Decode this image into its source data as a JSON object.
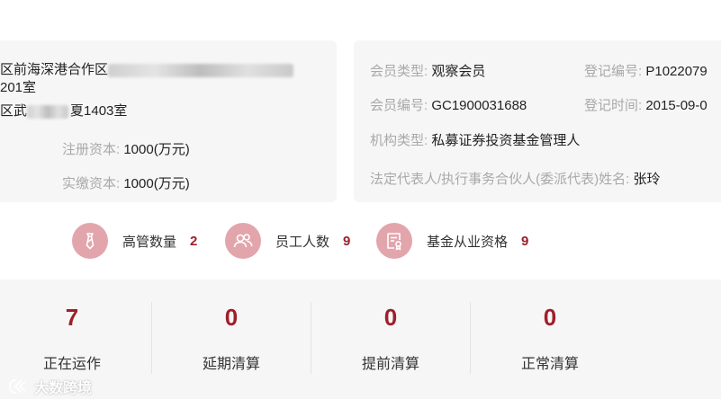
{
  "registration": {
    "address_line1": "区前海深港合作区",
    "address_line2": "201室",
    "address_line3_start": "区武",
    "address_line3_end": "夏1403室",
    "registered_capital_label": "注册资本:",
    "registered_capital_value": "1000(万元)",
    "paid_capital_label": "实缴资本:",
    "paid_capital_value": "1000(万元)"
  },
  "member": {
    "type_label": "会员类型:",
    "type_value": "观察会员",
    "reg_no_label": "登记编号:",
    "reg_no_value": "P1022079",
    "member_no_label": "会员编号:",
    "member_no_value": "GC1900031688",
    "reg_time_label": "登记时间:",
    "reg_time_value": "2015-09-0",
    "org_type_label": "机构类型:",
    "org_type_value": "私募证券投资基金管理人",
    "rep_label": "法定代表人/执行事务合伙人(委派代表)姓名:",
    "rep_value": "张玲"
  },
  "stats": [
    {
      "icon": "tie-icon",
      "label": "高管数量",
      "value": "2"
    },
    {
      "icon": "people-icon",
      "label": "员工人数",
      "value": "9"
    },
    {
      "icon": "certificate-icon",
      "label": "基金从业资格",
      "value": "9"
    }
  ],
  "products": [
    {
      "value": "7",
      "label": "正在运作"
    },
    {
      "value": "0",
      "label": "延期清算"
    },
    {
      "value": "0",
      "label": "提前清算"
    },
    {
      "value": "0",
      "label": "正常清算"
    }
  ],
  "watermark": "大数跨境",
  "colors": {
    "accent": "#9e1f2b",
    "icon_bg": "#e3a5ac",
    "panel_bg": "#f6f6f6"
  }
}
